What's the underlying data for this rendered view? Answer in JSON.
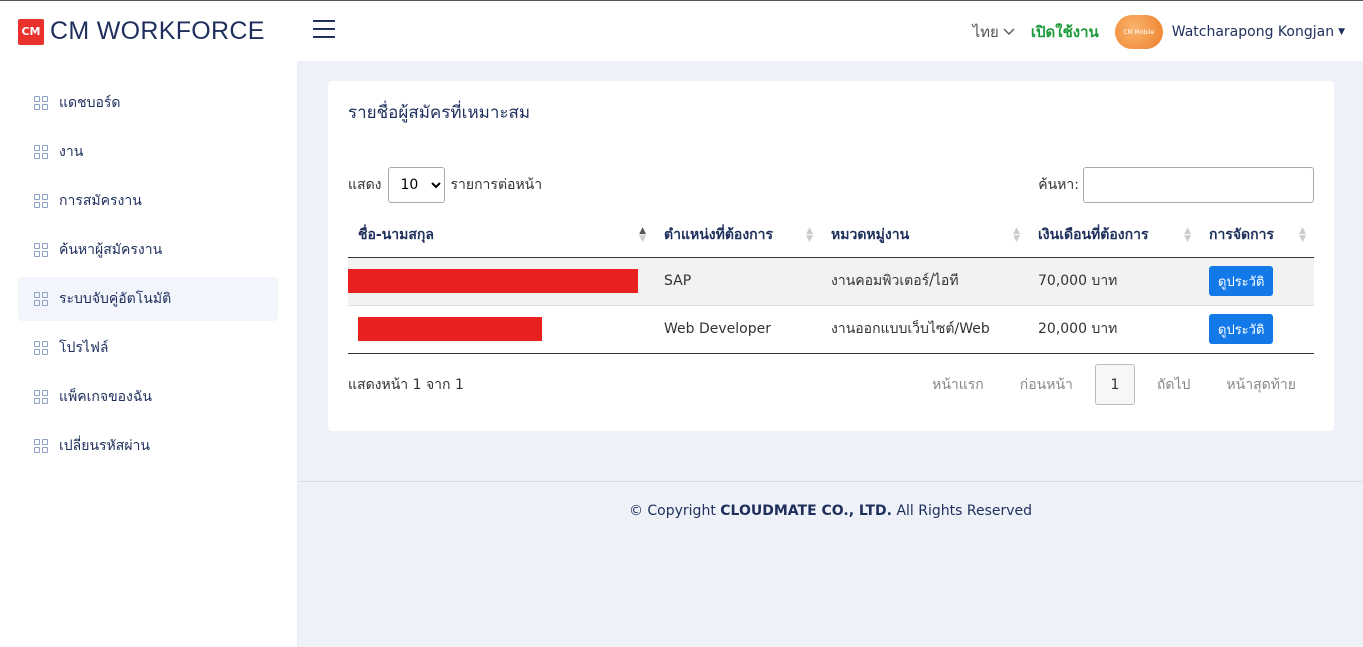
{
  "header": {
    "logo_mark": "CM",
    "logo_text": "CM WORKFORCE",
    "language": "ไทย",
    "status": "เปิดใช้งาน",
    "avatar_text": "CM Mobile",
    "user_name": "Watcharapong Kongjan",
    "accent_color": "#1e2f5c",
    "status_color": "#1d9a3a"
  },
  "sidebar": {
    "items": [
      {
        "label": "แดชบอร์ด"
      },
      {
        "label": "งาน"
      },
      {
        "label": "การสมัครงาน"
      },
      {
        "label": "ค้นหาผู้สมัครงาน"
      },
      {
        "label": "ระบบจับคู่อัตโนมัติ",
        "active": true
      },
      {
        "label": "โปรไฟล์"
      },
      {
        "label": "แพ็คเกจของฉัน"
      },
      {
        "label": "เปลี่ยนรหัสผ่าน"
      }
    ]
  },
  "main": {
    "title": "รายชื่อผู้สมัครที่เหมาะสม",
    "length": {
      "prefix": "แสดง",
      "value": "10",
      "suffix": "รายการต่อหน้า"
    },
    "search": {
      "label": "ค้นหา:",
      "value": ""
    },
    "table": {
      "columns": [
        "ชื่อ-นามสกุล",
        "ตำแหน่งที่ต้องการ",
        "หมวดหมู่งาน",
        "เงินเดือนที่ต้องการ",
        "การจัดการ"
      ],
      "rows": [
        {
          "name": "[redacted]",
          "position": "SAP",
          "category": "งานคอมพิวเตอร์/ไอที",
          "salary": "70,000 บาท",
          "action": "ดูประวัติ"
        },
        {
          "name": "[redacted]",
          "position": "Web Developer",
          "category": "งานออกแบบเว็บไซต์/Web",
          "salary": "20,000 บาท",
          "action": "ดูประวัติ"
        }
      ]
    },
    "info": "แสดงหน้า 1 จาก 1",
    "pager": {
      "first": "หน้าแรก",
      "prev": "ก่อนหน้า",
      "current": "1",
      "next": "ถัดไป",
      "last": "หน้าสุดท้าย"
    }
  },
  "footer": {
    "prefix": "© Copyright",
    "company": "CLOUDMATE CO., LTD.",
    "suffix": "All Rights Reserved"
  }
}
